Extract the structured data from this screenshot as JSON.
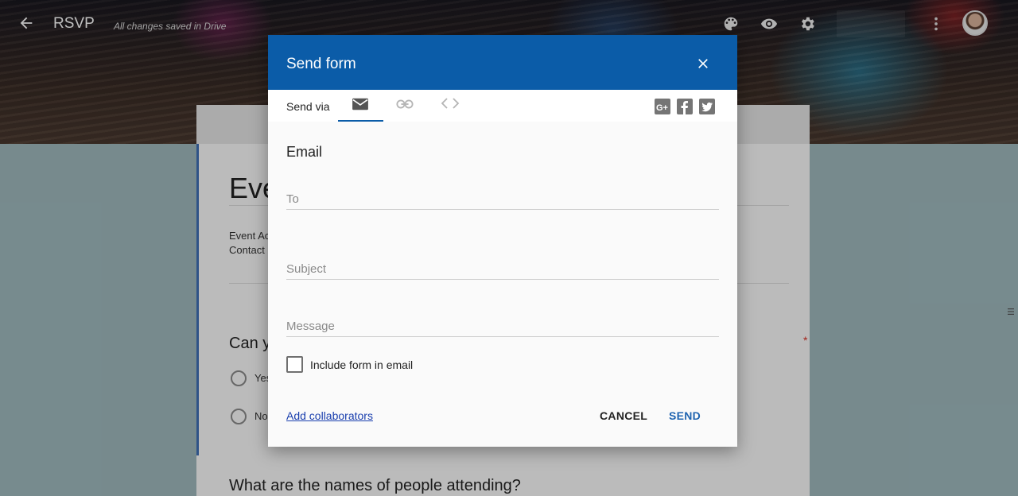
{
  "topbar": {
    "title": "RSVP",
    "saved_status": "All changes saved in Drive",
    "icons": [
      "back-arrow-icon",
      "palette-icon",
      "eye-icon",
      "gear-icon",
      "more-vert-icon"
    ]
  },
  "form": {
    "title": "Eve",
    "description": [
      "Event Ac",
      "Contact"
    ],
    "question1": {
      "title": "Can y",
      "required_mark": "*",
      "options": [
        "Yes",
        "No"
      ]
    },
    "question2": {
      "title": "What are the names of people attending?"
    }
  },
  "dialog": {
    "title": "Send form",
    "send_via_label": "Send via",
    "tabs": [
      "email-tab",
      "link-tab",
      "embed-tab"
    ],
    "social": [
      "google-plus-icon",
      "facebook-icon",
      "twitter-icon"
    ],
    "section_label": "Email",
    "fields": {
      "to_placeholder": "To",
      "subject_placeholder": "Subject",
      "message_placeholder": "Message"
    },
    "checkbox_label": "Include form in email",
    "add_collaborators": "Add collaborators",
    "cancel_label": "CANCEL",
    "send_label": "SEND"
  },
  "colors": {
    "dialog_header": "#0b5ca8",
    "page_background": "#9fb9bd",
    "send_button": "#1f64b0",
    "link": "#1a3fae"
  }
}
